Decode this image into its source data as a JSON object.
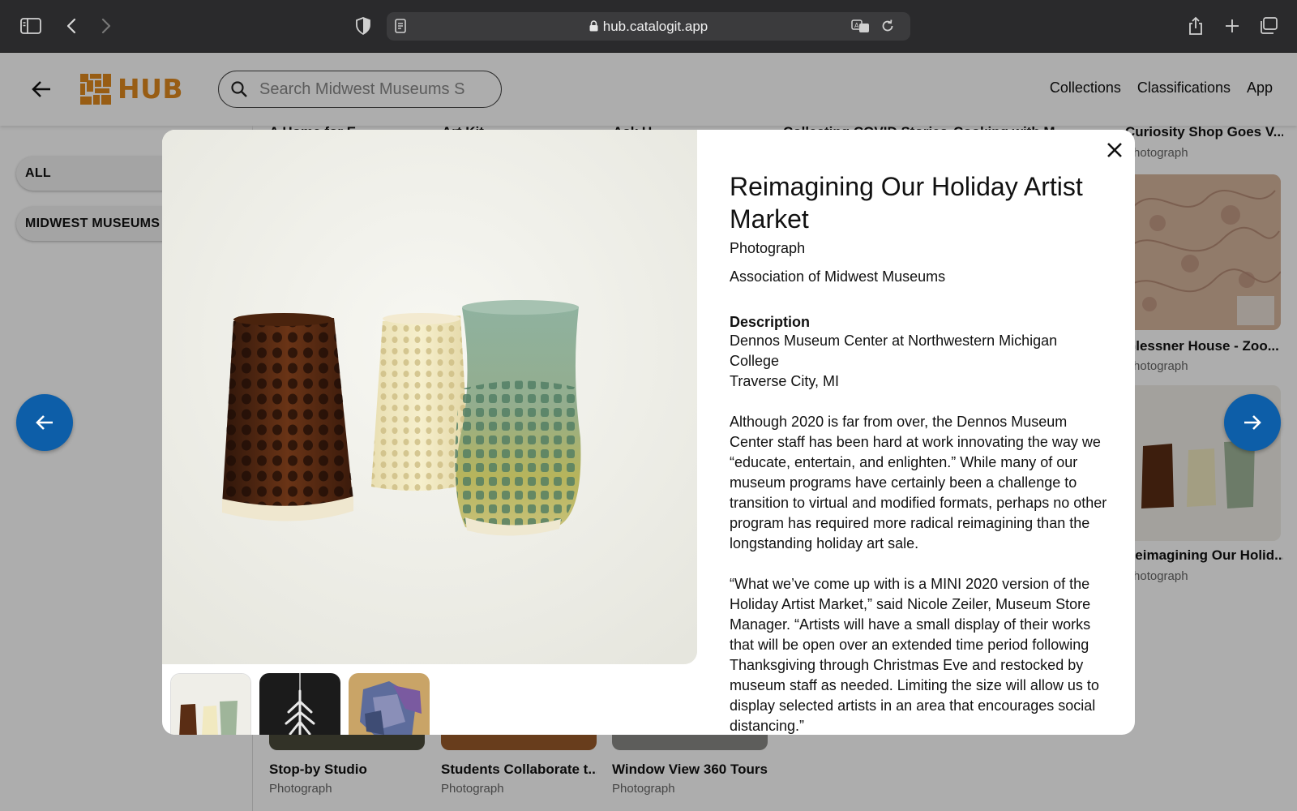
{
  "browser": {
    "url": "hub.catalogit.app"
  },
  "header": {
    "logo_text": "HUB",
    "search_placeholder": "Search Midwest Museums S",
    "nav": [
      "Collections",
      "Classifications",
      "App"
    ]
  },
  "sidebar": {
    "filters": [
      "ALL",
      "MIDWEST MUSEUMS"
    ]
  },
  "grid": {
    "top_row_titles": [
      "A Home for E...",
      "Art Kit",
      "Ask U...",
      "Collecting COVID Stories",
      "Cooking with M..."
    ],
    "right_column": [
      {
        "title": "Curiosity Shop Goes V...",
        "type": "Photograph"
      },
      {
        "title": "Glessner House - Zoo...",
        "type": "Photograph"
      },
      {
        "title": "Reimagining Our Holid...",
        "type": "Photograph"
      }
    ],
    "bottom_row": [
      {
        "title": "Stop-by Studio",
        "type": "Photograph"
      },
      {
        "title": "Students Collaborate t...",
        "type": "Photograph"
      },
      {
        "title": "Window View 360 Tours",
        "type": "Photograph"
      }
    ]
  },
  "modal": {
    "title": "Reimagining Our Holiday Artist Market",
    "type": "Photograph",
    "organization": "Association of Midwest Museums",
    "description_label": "Description",
    "location": "Dennos Museum Center at Northwestern Michigan College\nTraverse City, MI",
    "paragraph1": "Although 2020 is far from over, the Dennos Museum Center staff has been hard at work innovating the way we “educate, entertain, and enlighten.” While many of our museum programs have certainly been a challenge to transition to virtual and modified formats, perhaps no other program has required more radical reimagining than the longstanding holiday art sale.",
    "paragraph2": "“What we’ve come up with is a MINI 2020 version of the Holiday Artist Market,” said Nicole Zeiler, Museum Store Manager. “Artists will have a small display of their works that will be open over an extended time period following Thanksgiving through Christmas Eve and restocked by museum staff as needed. Limiting the size will allow us to display selected artists in an area that encourages social distancing.”"
  },
  "colors": {
    "brand_orange": "#e08a1e",
    "nav_button_blue": "#0d5ea8"
  }
}
